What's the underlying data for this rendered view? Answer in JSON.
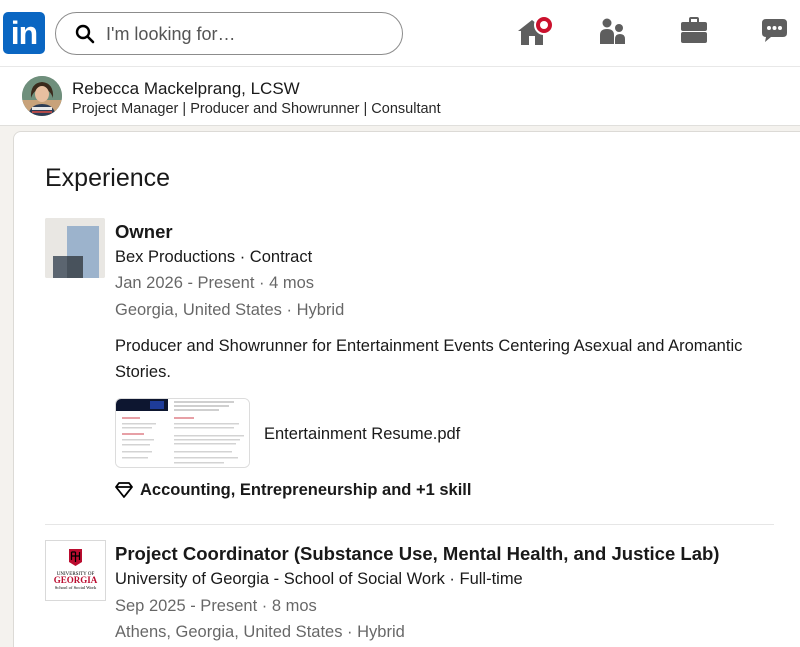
{
  "nav": {
    "logo_text": "in",
    "search_placeholder": "I'm looking for…",
    "icons": [
      "home-icon",
      "my-network-icon",
      "jobs-icon",
      "messaging-icon"
    ],
    "brand_color": "#0a66c2",
    "notification_color": "#cb112d"
  },
  "profile": {
    "name": "Rebecca Mackelprang, LCSW",
    "headline": "Project Manager | Producer and Showrunner | Consultant"
  },
  "experience": {
    "title": "Experience",
    "items": [
      {
        "role": "Owner",
        "company": "Bex Productions · Contract",
        "dates": "Jan 2026 - Present · 4 mos",
        "location": "Georgia, United States · Hybrid",
        "description": "Producer and Showrunner for Entertainment Events Centering Asexual and Aromantic Stories.",
        "media_title": "Entertainment Resume.pdf",
        "skills": "Accounting, Entrepreneurship and +1 skill"
      },
      {
        "role": "Project Coordinator (Substance Use, Mental Health, and Justice Lab)",
        "company": "University of Georgia - School of Social Work · Full-time",
        "dates": "Sep 2025 - Present · 8 mos",
        "location": "Athens, Georgia, United States · Hybrid",
        "logo_lines": [
          "UNIVERSITY OF",
          "GEORGIA",
          "School of Social Work"
        ]
      }
    ]
  }
}
